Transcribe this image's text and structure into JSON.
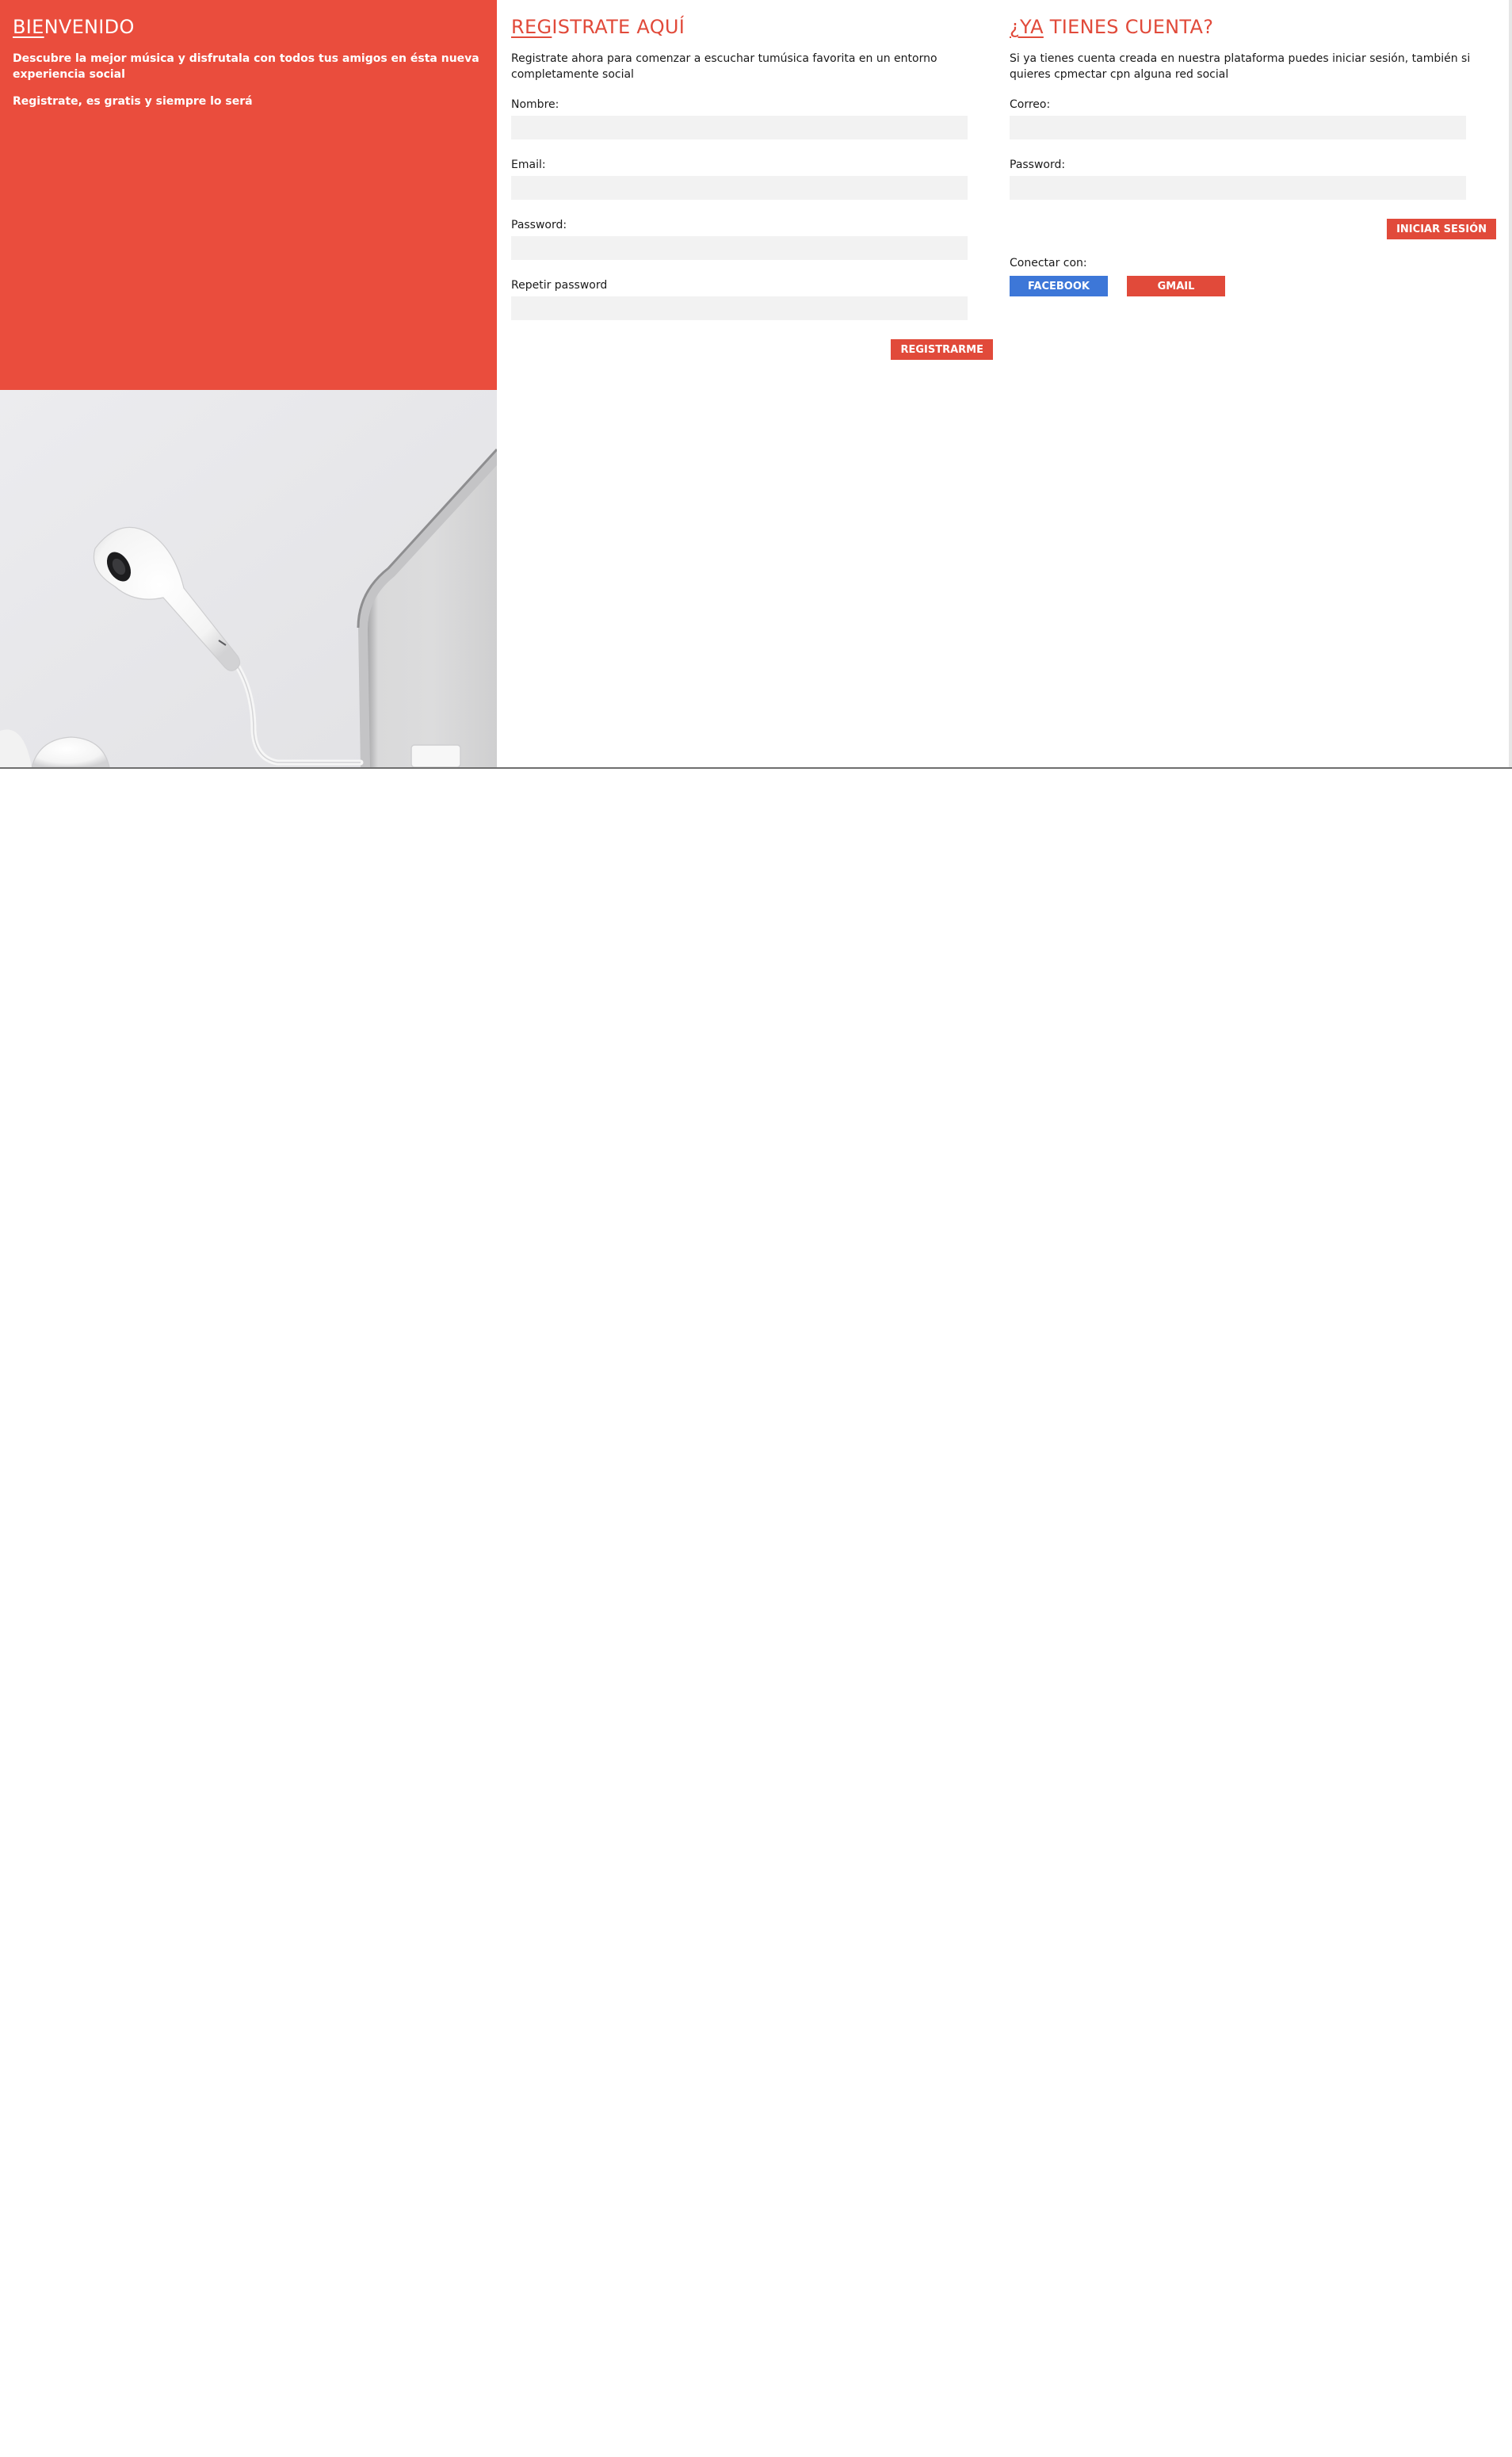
{
  "welcome": {
    "title_hl": "BIE",
    "title_rest": "NVENIDO",
    "text1": "Descubre la mejor música y disfrutala con todos tus amigos en ésta nueva experiencia social",
    "text2": "Registrate, es gratis y siempre lo será"
  },
  "register": {
    "title_hl": "REG",
    "title_rest": "ISTRATE AQUÍ",
    "intro": "Registrate ahora para comenzar a escuchar tumúsica favorita en un entorno completamente social",
    "fields": [
      {
        "label": "Nombre:",
        "value": ""
      },
      {
        "label": "Email:",
        "value": ""
      },
      {
        "label": "Password:",
        "value": ""
      },
      {
        "label": "Repetir password",
        "value": ""
      }
    ],
    "submit_label": "REGISTRARME"
  },
  "login": {
    "title_hl": "¿YA",
    "title_rest": " TIENES CUENTA?",
    "intro": "Si ya tienes cuenta creada en nuestra plataforma puedes iniciar sesión, también si quieres cpmectar cpn alguna red social",
    "fields": [
      {
        "label": "Correo:",
        "value": ""
      },
      {
        "label": "Password:",
        "value": ""
      }
    ],
    "submit_label": "INICIAR SESIÓN",
    "connect_label": "Conectar con:",
    "facebook_label": "FACEBOOK",
    "gmail_label": "GMAIL"
  },
  "colors": {
    "accent": "#e14a3a",
    "welcome_bg": "#ea4d3d",
    "facebook": "#3d77d8",
    "input_bg": "#f2f2f2"
  }
}
